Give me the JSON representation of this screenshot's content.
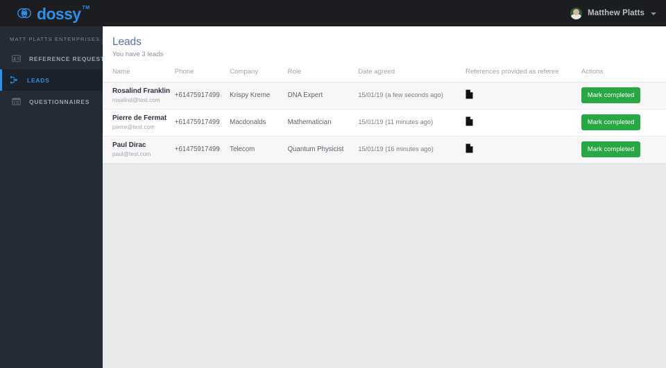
{
  "brand": {
    "name": "dossy",
    "tm": "TM",
    "logo_icon": "dossy-circles-logo"
  },
  "topbar": {
    "user_name": "Matthew Platts",
    "avatar_icon": "user-avatar",
    "caret_icon": "chevron-down-icon"
  },
  "sidebar": {
    "org_label": "MATT PLATTS ENTERPRISES D",
    "items": [
      {
        "label": "REFERENCE REQUESTS",
        "icon": "address-card-icon",
        "active": false
      },
      {
        "label": "LEADS",
        "icon": "sitemap-icon",
        "active": true
      },
      {
        "label": "QUESTIONNAIRES",
        "icon": "list-window-icon",
        "active": false
      }
    ]
  },
  "page": {
    "title": "Leads",
    "subtitle": "You have 3 leads"
  },
  "table": {
    "columns": [
      "Name",
      "Phone",
      "Company",
      "Role",
      "Date agreed",
      "References provided as referee",
      "Actions"
    ],
    "rows": [
      {
        "name": "Rosalind Franklin",
        "email": "rosalind@test.com",
        "phone": "+61475917499",
        "company": "Krispy Kreme",
        "role": "DNA Expert",
        "date_agreed": "15/01/19 (a few seconds ago)",
        "references_icon": "file-document-icon",
        "action_label": "Mark completed"
      },
      {
        "name": "Pierre de Fermat",
        "email": "pierre@test.com",
        "phone": "+61475917499",
        "company": "Macdonalds",
        "role": "Mathematician",
        "date_agreed": "15/01/19 (11 minutes ago)",
        "references_icon": "file-document-icon",
        "action_label": "Mark completed"
      },
      {
        "name": "Paul Dirac",
        "email": "paul@test.com",
        "phone": "+61475917499",
        "company": "Telecom",
        "role": "Quantum Physicist",
        "date_agreed": "15/01/19 (16 minutes ago)",
        "references_icon": "file-document-icon",
        "action_label": "Mark completed"
      }
    ]
  },
  "colors": {
    "brand_blue": "#2e8fe8",
    "title_blue": "#5b6fa8",
    "success_green": "#28a745",
    "topbar_dark": "#1b1d21",
    "sidebar_dark": "#242b35",
    "sidebar_active": "#1c222b",
    "page_bg": "#e9eaec"
  }
}
